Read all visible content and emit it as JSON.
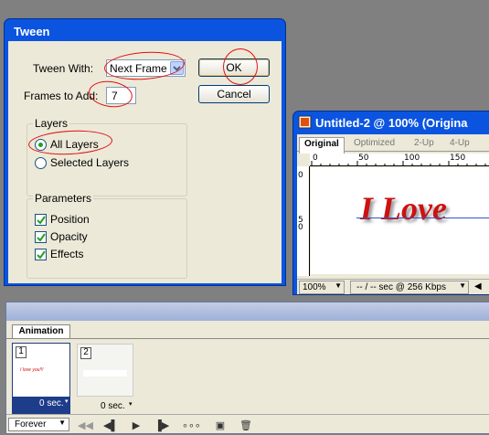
{
  "dialog": {
    "title": "Tween",
    "tween_with_label": "Tween With:",
    "tween_with_value": "Next Frame",
    "frames_to_add_label": "Frames to Add:",
    "frames_to_add_value": "7",
    "ok_label": "OK",
    "cancel_label": "Cancel",
    "layers_group": "Layers",
    "all_layers": "All Layers",
    "selected_layers": "Selected Layers",
    "layers_selected": "all_layers",
    "parameters_group": "Parameters",
    "position": "Position",
    "opacity": "Opacity",
    "effects": "Effects",
    "position_checked": true,
    "opacity_checked": true,
    "effects_checked": true
  },
  "image_window": {
    "title": "Untitled-2 @ 100% (Origina",
    "tabs": [
      "Original",
      "Optimized",
      "2-Up",
      "4-Up"
    ],
    "active_tab": "Original",
    "ruler_top": [
      "0",
      "50",
      "100",
      "150"
    ],
    "ruler_left": [
      "0",
      "5\n0"
    ],
    "canvas_text": "I Love",
    "zoom": "100%",
    "speed": "-- / -- sec @ 256 Kbps"
  },
  "animation": {
    "tab": "Animation",
    "frames": [
      {
        "number": "1",
        "delay": "0 sec.",
        "thumb_text": "I love you!!!"
      },
      {
        "number": "2",
        "delay": "0 sec.",
        "thumb_text": ""
      }
    ],
    "loop": "Forever"
  },
  "colors": {
    "xp_blue": "#0a54e0",
    "dialog_bg": "#ece9d8",
    "annotation_red": "#e01010",
    "love_text": "#cc1111"
  }
}
